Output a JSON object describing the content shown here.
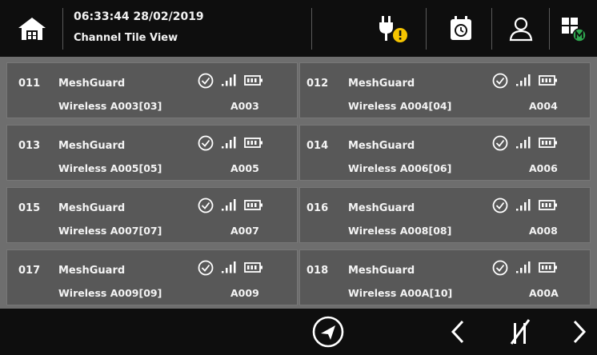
{
  "header": {
    "time": "06:33:44 28/02/2019",
    "view": "Channel Tile View",
    "icons": [
      "home-icon",
      "power-alert-icon",
      "timer-icon",
      "user-icon",
      "modules-icon"
    ],
    "alert_color": "#f5c400",
    "module_badge_color": "#2fa84f"
  },
  "tiles": [
    {
      "num": "011",
      "name": "MeshGuard",
      "desc": "Wireless A003[03]",
      "code": "A003"
    },
    {
      "num": "012",
      "name": "MeshGuard",
      "desc": "Wireless A004[04]",
      "code": "A004"
    },
    {
      "num": "013",
      "name": "MeshGuard",
      "desc": "Wireless A005[05]",
      "code": "A005"
    },
    {
      "num": "014",
      "name": "MeshGuard",
      "desc": "Wireless A006[06]",
      "code": "A006"
    },
    {
      "num": "015",
      "name": "MeshGuard",
      "desc": "Wireless A007[07]",
      "code": "A007"
    },
    {
      "num": "016",
      "name": "MeshGuard",
      "desc": "Wireless A008[08]",
      "code": "A008"
    },
    {
      "num": "017",
      "name": "MeshGuard",
      "desc": "Wireless A009[09]",
      "code": "A009"
    },
    {
      "num": "018",
      "name": "MeshGuard",
      "desc": "Wireless A00A[10]",
      "code": "A00A"
    }
  ],
  "tile_icons": [
    "check-icon",
    "signal-icon",
    "battery-icon"
  ],
  "footer": {
    "icons": [
      "navigate-icon",
      "previous-icon",
      "view-toggle-icon",
      "next-icon"
    ]
  }
}
